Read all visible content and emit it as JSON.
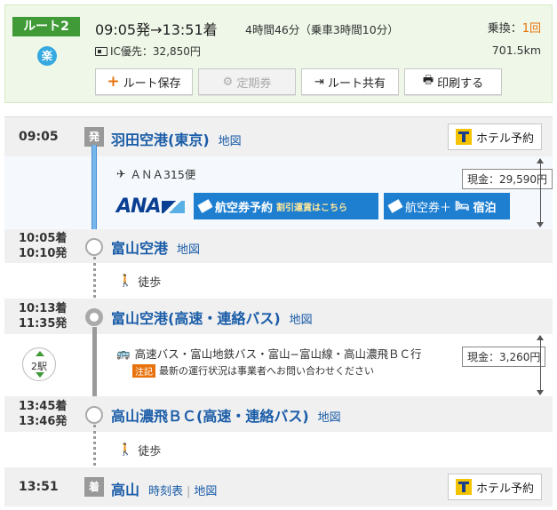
{
  "summary": {
    "route_label": "ルート2",
    "raku_label": "楽",
    "times": "09:05発→13:51着",
    "duration": "4時間46分（乗車3時間10分）",
    "fare": "IC優先：32,850円",
    "transfer_label": "乗換：",
    "transfer_count": "1回",
    "distance": "701.5km",
    "buttons": {
      "save": "ルート保存",
      "commuter": "定期券",
      "share": "ルート共有",
      "print": "印刷する"
    }
  },
  "stations": [
    {
      "time": "09:05",
      "badge": "発",
      "name": "羽田空港(東京)",
      "map": "地図",
      "hotel": "ホテル予約"
    },
    {
      "time_arr": "10:05着",
      "time_dep": "10:10発",
      "name": "富山空港",
      "map": "地図"
    },
    {
      "time_arr": "10:13着",
      "time_dep": "11:35発",
      "name": "富山空港(高速・連絡バス)",
      "map": "地図"
    },
    {
      "time_arr": "13:45着",
      "time_dep": "13:46発",
      "name": "高山濃飛ＢＣ(高速・連絡バス)",
      "map": "地図"
    },
    {
      "time": "13:51",
      "badge": "着",
      "name": "高山",
      "timetable": "時刻表",
      "map": "地図",
      "hotel": "ホテル予約"
    }
  ],
  "flight": {
    "service": "ＡＮＡ315便",
    "logo_text": "ANA",
    "book_label": "航空券予約",
    "book_sub": "割引運賃はこちら",
    "combo_label": "航空券＋",
    "combo_sub": "宿泊",
    "price": "現金：29,590円"
  },
  "bus": {
    "service": "高速バス・富山地鉄バス・富山−富山線・高山濃飛ＢＣ行",
    "notice_tag": "注記",
    "notice": "最新の運行状況は事業者へお問い合わせください",
    "stops": "2駅",
    "price": "現金：3,260円"
  },
  "walk_label": "徒歩",
  "colors": {
    "green": "#3f9a37",
    "blue_line": "#76b6ea",
    "link": "#1a5ca8",
    "orange": "#e8730e"
  }
}
